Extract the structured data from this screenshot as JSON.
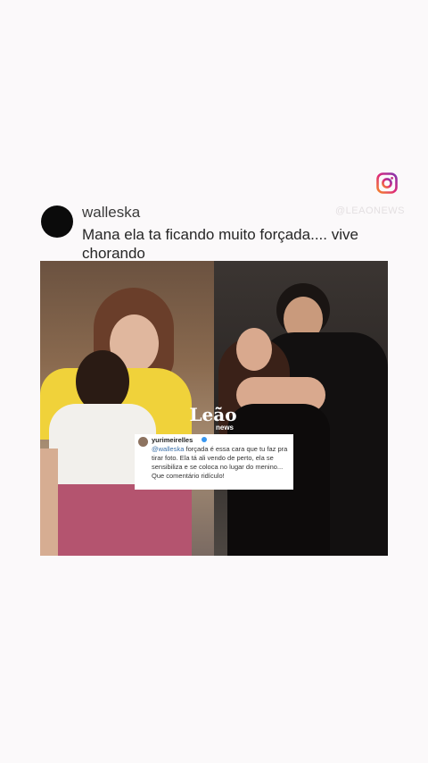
{
  "header": {
    "watermark": "@LEAONEWS",
    "instagram_icon": "instagram-icon"
  },
  "comment": {
    "username": "walleska",
    "text": "Mana ela ta ficando muito forçada.... vive chorando"
  },
  "post_image": {
    "logo_top": "Leão",
    "logo_bottom": "news",
    "reply": {
      "username": "yurimeirelles",
      "mention": "@walleska",
      "text": "forçada é essa cara que tu faz pra tirar foto. Ela tá ali vendo de perto, ela se sensibiliza e se coloca no lugar do menino... Que comentário ridículo!"
    }
  },
  "colors": {
    "background": "#fbf9fa",
    "instagram_gradient": [
      "#f58529",
      "#dd2a7b",
      "#8134af"
    ]
  }
}
